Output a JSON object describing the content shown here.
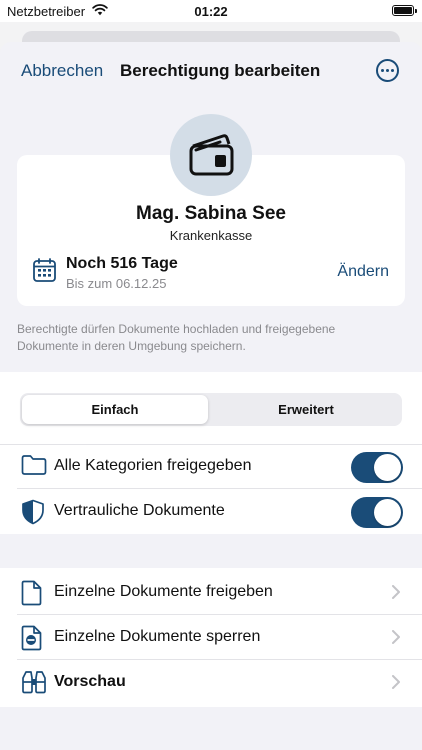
{
  "status_bar": {
    "carrier": "Netzbetreiber",
    "time": "01:22"
  },
  "nav": {
    "cancel_label": "Abbrechen",
    "title": "Berechtigung bearbeiten",
    "more_icon": "ellipsis-circle-icon"
  },
  "profile": {
    "avatar_icon": "wallet-card-icon",
    "name": "Mag. Sabina See",
    "organization": "Krankenkasse",
    "validity": {
      "remaining": "Noch 516 Tage",
      "until": "Bis zum 06.12.25",
      "change_label": "Ändern",
      "icon": "calendar-icon"
    }
  },
  "description": "Berechtigte dürfen Dokumente hochladen und freigegebene Dokumente in deren Umgebung speichern.",
  "segmented": {
    "options": [
      "Einfach",
      "Erweitert"
    ],
    "selected": "Einfach"
  },
  "toggles": [
    {
      "label": "Alle Kategorien freigegeben",
      "icon": "folder-icon",
      "on": true
    },
    {
      "label": "Vertrauliche Dokumente",
      "icon": "shield-icon",
      "on": true
    }
  ],
  "actions": [
    {
      "label": "Einzelne Dokumente freigeben",
      "icon": "document-icon"
    },
    {
      "label": "Einzelne Dokumente sperren",
      "icon": "document-minus-icon"
    },
    {
      "label": "Vorschau",
      "icon": "binoculars-icon"
    }
  ],
  "colors": {
    "accent": "#1a4c78",
    "background": "#f2f2f7",
    "avatar_bg": "#d3dde7",
    "secondary_text": "#8a8a8e"
  }
}
